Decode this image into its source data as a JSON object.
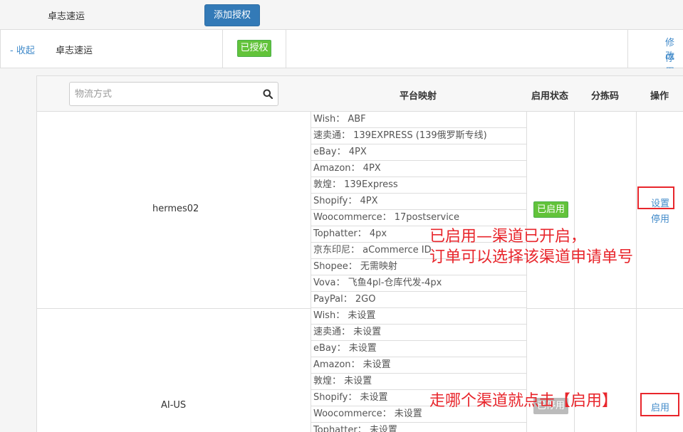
{
  "header": {
    "provider_name": "卓志速运",
    "add_auth_button": "添加授权"
  },
  "provider_row": {
    "collapse_link": "- 收起",
    "provider_name": "卓志速运",
    "auth_status": "已授权",
    "edit_link": "修改",
    "stop_link": "停用"
  },
  "table": {
    "search_placeholder": "物流方式",
    "columns": {
      "mapping": "平台映射",
      "status": "启用状态",
      "sort_code": "分拣码",
      "actions": "操作"
    },
    "rows": [
      {
        "name": "hermes02",
        "mappings": [
          "Wish： ABF",
          "速卖通： 139EXPRESS (139俄罗斯专线)",
          "eBay： 4PX",
          "Amazon： 4PX",
          "敦煌： 139Express",
          "Shopify： 4PX",
          "Woocommerce： 17postservice",
          "Tophatter： 4px",
          "京东印尼： aCommerce ID",
          "Shopee： 无需映射",
          "Vova： 飞鱼4pl-仓库代发-4px",
          "PayPal： 2GO"
        ],
        "status": "已启用",
        "action_primary": "设置",
        "action_secondary": "停用"
      },
      {
        "name": "AI-US",
        "mappings": [
          "Wish： 未设置",
          "速卖通： 未设置",
          "eBay： 未设置",
          "Amazon： 未设置",
          "敦煌： 未设置",
          "Shopify： 未设置",
          "Woocommerce： 未设置",
          "Tophatter： 未设置"
        ],
        "status": "已停用",
        "action_primary": "启用"
      }
    ]
  },
  "annotations": {
    "enabled_note_line1": "已启用—渠道已开启，",
    "enabled_note_line2": "订单可以选择该渠道申请单号",
    "enable_note": "走哪个渠道就点击【启用】"
  },
  "colors": {
    "primary": "#337ab7",
    "link": "#428bca",
    "success": "#62c33a",
    "annotation_red": "#e8262c"
  }
}
